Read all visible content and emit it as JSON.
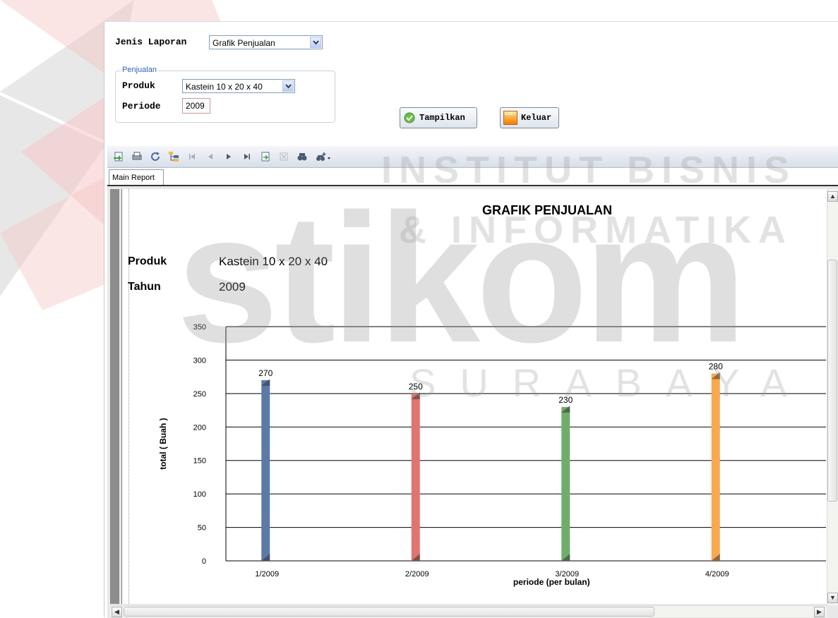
{
  "form": {
    "jenis_label": "Jenis Laporan",
    "jenis_value": "Grafik Penjualan",
    "group_legend": "Penjualan",
    "produk_label": "Produk",
    "produk_value": "Kastein 10 x 20 x 40",
    "periode_label": "Periode",
    "periode_value": "2009",
    "tampilkan_label": "Tampilkan",
    "keluar_label": "Keluar",
    "keluar_icon_text": "EXIT"
  },
  "viewer": {
    "tab_label": "Main Report",
    "toolbar_icons": [
      "export-icon",
      "print-icon",
      "refresh-icon",
      "group-tree-icon",
      "first-page-icon",
      "previous-page-icon",
      "next-page-icon",
      "last-page-icon",
      "goto-page-icon",
      "stop-icon",
      "search-icon",
      "zoom-icon"
    ]
  },
  "report": {
    "title": "GRAFIK PENJUALAN",
    "produk_label": "Produk",
    "produk_value": "Kastein 10 x 20 x 40",
    "tahun_label": "Tahun",
    "tahun_value": "2009"
  },
  "watermark": {
    "line1": "INSTITUT BISNIS",
    "line2": "& INFORMATIKA",
    "brand": "stikom",
    "city": "SURABAYA"
  },
  "chart_data": {
    "type": "bar",
    "categories": [
      "1/2009",
      "2/2009",
      "3/2009",
      "4/2009"
    ],
    "values": [
      270,
      250,
      230,
      280
    ],
    "colors": [
      "#5b7aa8",
      "#e07470",
      "#70ad6c",
      "#f8a84e"
    ],
    "xlabel": "periode (per bulan)",
    "ylabel": "total ( Buah )",
    "ylim": [
      0,
      350
    ],
    "yticks": [
      0,
      50,
      100,
      150,
      200,
      250,
      300,
      350
    ],
    "grid": true,
    "data_labels": true
  }
}
